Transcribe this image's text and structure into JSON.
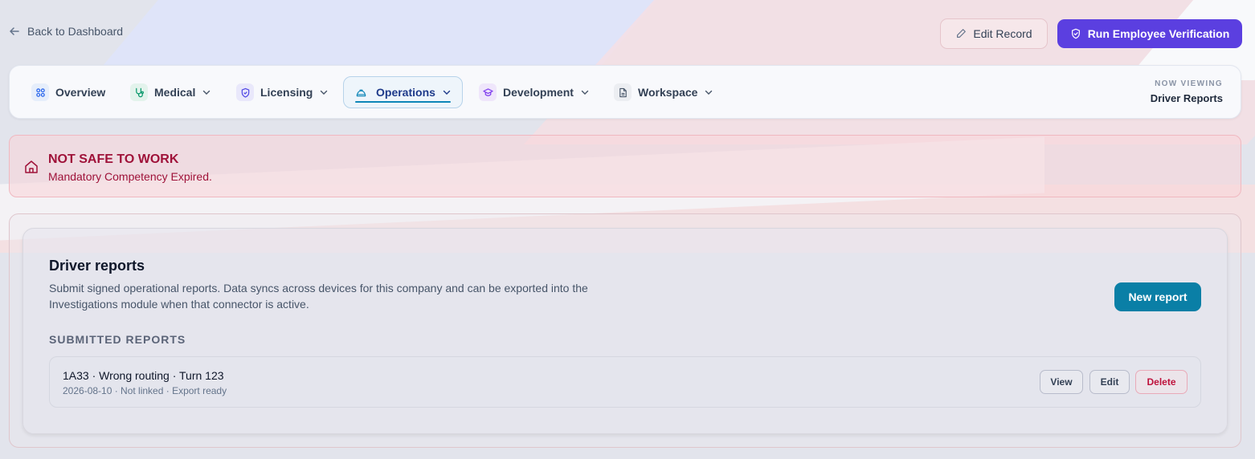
{
  "header": {
    "back_label": "Back to Dashboard",
    "edit_label": "Edit Record",
    "run_label": "Run Employee Verification"
  },
  "nav": {
    "tabs": [
      {
        "label": "Overview",
        "icon": "grid-icon",
        "color": "#2563eb"
      },
      {
        "label": "Medical",
        "icon": "stethoscope-icon",
        "color": "#059669"
      },
      {
        "label": "Licensing",
        "icon": "shield-check-icon",
        "color": "#4f46e5"
      },
      {
        "label": "Operations",
        "icon": "hard-hat-icon",
        "color": "#0e86b8"
      },
      {
        "label": "Development",
        "icon": "graduation-cap-icon",
        "color": "#7c3aed"
      },
      {
        "label": "Workspace",
        "icon": "document-icon",
        "color": "#475569"
      }
    ],
    "active_tab": "Operations",
    "now_viewing_label": "NOW VIEWING",
    "now_viewing_value": "Driver Reports"
  },
  "alert": {
    "title": "NOT SAFE TO WORK",
    "message": "Mandatory Competency Expired.",
    "icon": "home-icon",
    "color": "#9f1239"
  },
  "reports": {
    "title": "Driver reports",
    "description": "Submit signed operational reports. Data syncs across devices for this company and can be exported into the Investigations module when that connector is active.",
    "new_button": "New report",
    "section_label": "SUBMITTED REPORTS",
    "items": [
      {
        "title": "1A33 · Wrong routing · Turn 123",
        "meta": "2026-08-10 · Not linked · Export ready",
        "view_label": "View",
        "edit_label": "Edit",
        "delete_label": "Delete"
      }
    ]
  },
  "colors": {
    "primary": "#5b3fe0",
    "accent": "#0a7fa6",
    "danger": "#be123c"
  }
}
